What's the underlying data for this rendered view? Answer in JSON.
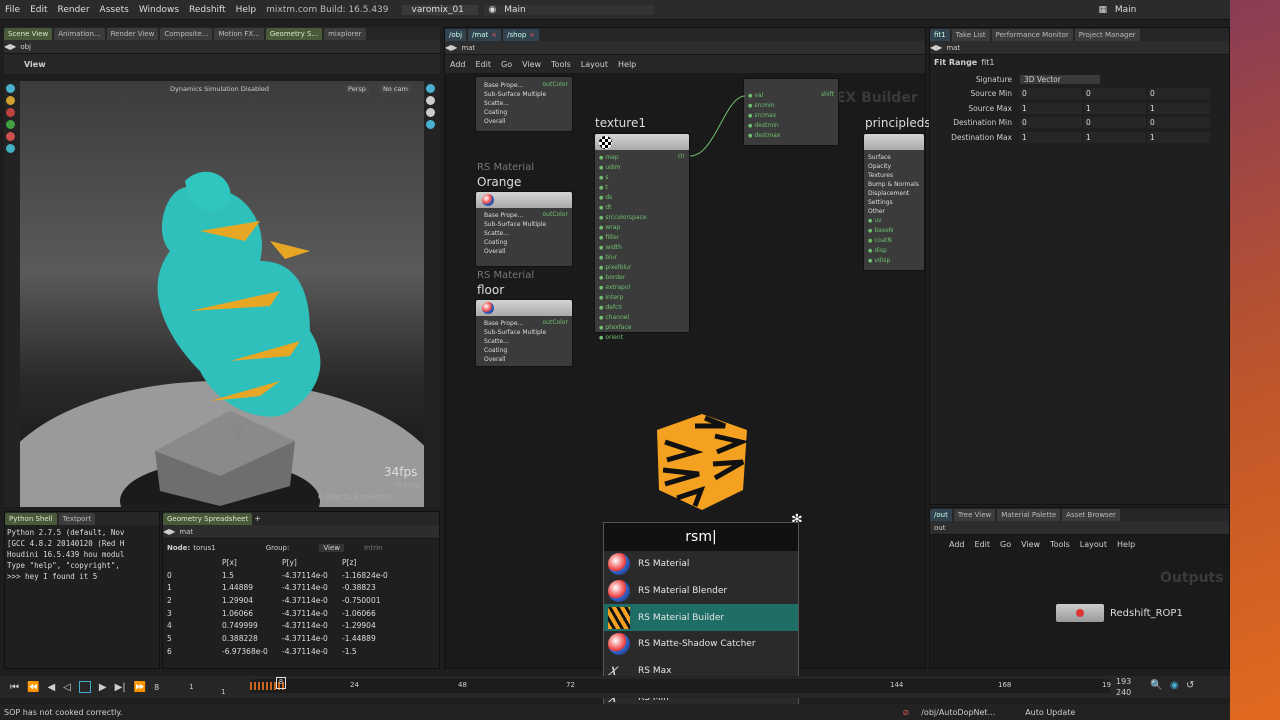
{
  "menubar": {
    "items": [
      "File",
      "Edit",
      "Render",
      "Assets",
      "Windows",
      "Redshift",
      "Help"
    ],
    "title": "mixtm.com Build: 16.5.439",
    "desktop": "varomix_01",
    "desktop_right": "Main",
    "desktop_right2": "Main"
  },
  "scene_view": {
    "tabs": [
      "Scene View",
      "Animation...",
      "Render View",
      "Composite...",
      "Motion FX...",
      "Geometry S...",
      "mixplorer"
    ],
    "path": "obj",
    "title": "View",
    "sim_status": "Dynamics Simulation Disabled",
    "persp": "Persp",
    "cam": "No cam",
    "fps": "34fps",
    "ms": "29.60ms",
    "selection": "6 objects, 0 selected",
    "box_letter": "Y"
  },
  "console": {
    "tabs": [
      "Python Shell",
      "Textport"
    ],
    "lines": [
      "Python 2.7.5 (default, Nov",
      "[GCC 4.8.2 20140120 (Red H",
      "Houdini 16.5.439 hou modul",
      "Type \"help\", \"copyright\",",
      ">>> hey I found it 5"
    ]
  },
  "spreadsheet": {
    "tab": "Geometry Spreadsheet",
    "path": "mat",
    "node_label": "Node:",
    "node": "torus1",
    "group_label": "Group:",
    "view": "View",
    "intrinsics": "Intrin",
    "headers": [
      "",
      "P[x]",
      "P[y]",
      "P[z]"
    ],
    "rows": [
      [
        "0",
        "1.5",
        "-4.37114e-0",
        "-1.16824e-0"
      ],
      [
        "1",
        "1.44889",
        "-4.37114e-0",
        "-0.38823"
      ],
      [
        "2",
        "1.29904",
        "-4.37114e-0",
        "-0.750001"
      ],
      [
        "3",
        "1.06066",
        "-4.37114e-0",
        "-1.06066"
      ],
      [
        "4",
        "0.749999",
        "-4.37114e-0",
        "-1.29904"
      ],
      [
        "5",
        "0.388228",
        "-4.37114e-0",
        "-1.44889"
      ],
      [
        "6",
        "-6.97368e-0",
        "-4.37114e-0",
        "-1.5"
      ]
    ]
  },
  "network": {
    "tabs": [
      "/obj",
      "/mat",
      "/shop"
    ],
    "path": "mat",
    "menu": [
      "Add",
      "Edit",
      "Go",
      "View",
      "Tools",
      "Layout",
      "Help"
    ],
    "watermark": "VEX Builder",
    "mat_top": {
      "params": [
        "Base Prope...",
        "Sub-Surface Multiple Scatte...",
        "Coating",
        "Overall"
      ],
      "out": "outColor"
    },
    "mat_orange": {
      "type": "RS Material",
      "name": "Orange",
      "params": [
        "Base Prope...",
        "Sub-Surface Multiple Scatte...",
        "Coating",
        "Overall"
      ],
      "out": "outColor"
    },
    "mat_floor": {
      "type": "RS Material",
      "name": "floor",
      "params": [
        "Base Prope...",
        "Sub-Surface Multiple Scatte...",
        "Coating",
        "Overall"
      ],
      "out": "outColor"
    },
    "texture": {
      "name": "texture1",
      "inputs": [
        "map",
        "udim",
        "s",
        "t",
        "ds",
        "dt",
        "srccolorspace",
        "wrap",
        "filter",
        "width",
        "blur",
        "pixelblur",
        "border",
        "extrapol",
        "interp",
        "defclr",
        "channel",
        "ptexface",
        "orient"
      ],
      "out": "clr"
    },
    "fit": {
      "inputs": [
        "val",
        "srcmin",
        "srcmax",
        "destmin",
        "destmax"
      ],
      "out": "shift"
    },
    "principled": {
      "name": "principleds",
      "params": [
        "Surface",
        "Opacity",
        "Textures",
        "Bump & Normals",
        "Displacement",
        "Settings",
        "Other"
      ],
      "inputs": [
        "uv",
        "baseN",
        "coatN",
        "disp",
        "vdisp"
      ],
      "dis": "dis"
    },
    "search": {
      "value": "rsm",
      "items": [
        "RS Material",
        "RS Material Blender",
        "RS Material Builder",
        "RS Matte-Shadow Catcher",
        "RS Max",
        "RS Min"
      ],
      "selected": 2
    }
  },
  "params": {
    "tabs": [
      "fit1",
      "Take List",
      "Performance Monitor",
      "Project Manager"
    ],
    "path": "mat",
    "type": "Fit Range",
    "name": "fit1",
    "signature_label": "Signature",
    "signature": "3D Vector",
    "rows": [
      {
        "label": "Source Min",
        "v": [
          "0",
          "0",
          "0"
        ]
      },
      {
        "label": "Source Max",
        "v": [
          "1",
          "1",
          "1"
        ]
      },
      {
        "label": "Destination Min",
        "v": [
          "0",
          "0",
          "0"
        ]
      },
      {
        "label": "Destination Max",
        "v": [
          "1",
          "1",
          "1"
        ]
      }
    ]
  },
  "out_network": {
    "tabs": [
      "/out",
      "Tree View",
      "Material Palette",
      "Asset Browser"
    ],
    "path": "out",
    "menu": [
      "Add",
      "Edit",
      "Go",
      "View",
      "Tools",
      "Layout",
      "Help"
    ],
    "watermark": "Outputs",
    "node": "Redshift_ROP1"
  },
  "timeline": {
    "start": "1",
    "start2": "1",
    "current": "8",
    "ticks": [
      "8",
      "24",
      "48",
      "72",
      "144",
      "168",
      "19"
    ],
    "end": "193",
    "end2": "240",
    "frame": "8"
  },
  "status": {
    "message": "SOP has not cooked correctly.",
    "path": "/obj/AutoDopNet...",
    "auto_update": "Auto Update"
  },
  "colors": {
    "accent": "#1f6e66",
    "tabGreen": "#485a3a",
    "port": "#6fbf6f",
    "error": "#e25a5a"
  }
}
